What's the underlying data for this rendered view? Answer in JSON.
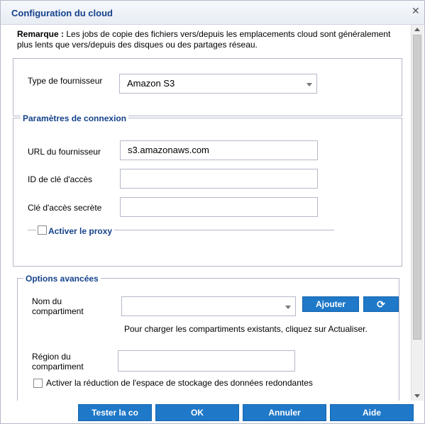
{
  "dialog": {
    "title": "Configuration du cloud"
  },
  "note": {
    "label": "Remarque :",
    "text": "Les jobs de copie des fichiers vers/depuis les emplacements cloud sont généralement plus lents que vers/depuis des disques ou des partages réseau."
  },
  "provider": {
    "label": "Type de fournisseur",
    "value": "Amazon S3"
  },
  "connection": {
    "legend": "Paramètres de connexion",
    "url_label": "URL du fournisseur",
    "url_value": "s3.amazonaws.com",
    "access_key_label": "ID de clé d'accès",
    "access_key_value": "",
    "secret_label": "Clé d'accès secrète",
    "secret_value": "",
    "proxy_label": "Activer le proxy"
  },
  "advanced": {
    "legend": "Options avancées",
    "bucket_label": "Nom du compartiment",
    "bucket_value": "",
    "add_button": "Ajouter",
    "refresh_hint": "Pour charger les compartiments existants, cliquez sur Actualiser.",
    "region_label": "Région du compartiment",
    "region_value": "",
    "rrs_label": "Activer la réduction de l'espace de stockage des données redondantes"
  },
  "footer": {
    "test_button": "Tester la co",
    "ok_button": "OK",
    "cancel_button": "Annuler",
    "help_button": "Aide"
  },
  "colors": {
    "accent": "#1f78c8",
    "title": "#15428b",
    "border": "#b5b8c8"
  }
}
